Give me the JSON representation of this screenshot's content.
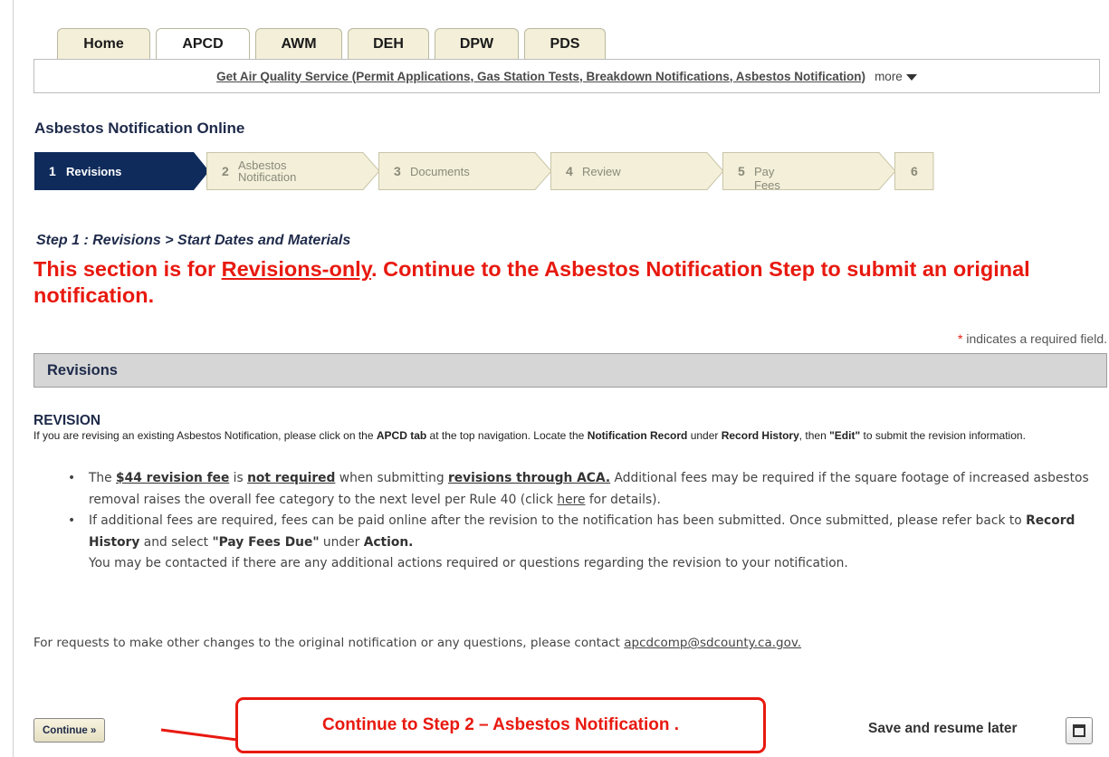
{
  "tabs": [
    {
      "label": "Home",
      "active": false
    },
    {
      "label": "APCD",
      "active": true
    },
    {
      "label": "AWM",
      "active": false
    },
    {
      "label": "DEH",
      "active": false
    },
    {
      "label": "DPW",
      "active": false
    },
    {
      "label": "PDS",
      "active": false
    }
  ],
  "subnav": {
    "link": "Get Air Quality Service (Permit Applications, Gas Station Tests, Breakdown Notifications, Asbestos Notification)",
    "more": "more"
  },
  "page_title": "Asbestos Notification Online",
  "steps": [
    {
      "num": "1",
      "label": "Revisions",
      "active": true
    },
    {
      "num": "2",
      "label_line1": "Asbestos",
      "label_line2": "Notification",
      "active": false
    },
    {
      "num": "3",
      "label": "Documents",
      "active": false
    },
    {
      "num": "4",
      "label": "Review",
      "active": false
    },
    {
      "num": "5",
      "label": "Pay Fees",
      "active": false
    },
    {
      "num": "6",
      "label": "",
      "active": false
    }
  ],
  "step_heading": "Step 1 : Revisions > Start Dates and Materials",
  "warning": {
    "pre": "This section is for ",
    "underlined": "Revisions-only",
    "post": ". Continue to the Asbestos Notification Step to submit an original notification."
  },
  "required_note": {
    "star": "*",
    "text": "indicates a required field."
  },
  "section_title": "Revisions",
  "revision": {
    "title": "REVISION",
    "t1": "If you are revising an existing Asbestos Notification, please click on the ",
    "b1": "APCD tab",
    "t2": " at the top navigation. Locate the ",
    "b2": "Notification Record",
    "t3": " under ",
    "b3": "Record History",
    "t4": ", then ",
    "b4": "\"Edit\"",
    "t5": " to submit the revision information."
  },
  "bullet1": {
    "t1": "The ",
    "b1": "$44 revision fee",
    "t2": " is ",
    "b2": "not required",
    "t3": " when submitting ",
    "b3": "revisions through ACA.",
    "t4": " Additional fees may be required if the square footage of increased asbestos removal raises the overall fee category to the next level per Rule 40 (click ",
    "link": "here",
    "t5": " for details)."
  },
  "bullet2": {
    "t1": "If additional fees are required, fees can be paid online after the revision to the notification has been submitted. Once submitted, please refer back to ",
    "b1": "Record History",
    "t2": " and select ",
    "b2": "\"Pay Fees Due\"",
    "t3": " under ",
    "b3": "Action.",
    "t4": "You may be contacted if there are any additional actions required or questions regarding the revision to your notification."
  },
  "contact": {
    "text": "For requests to make other changes to the original notification or any questions, please contact ",
    "email": "apcdcomp@sdcounty.ca.gov."
  },
  "continue_label": "Continue »",
  "callout_text": "Continue to Step 2 – Asbestos Notification .",
  "save_later": "Save and resume later",
  "colors": {
    "accent_red": "#e8190f",
    "navy": "#0f2b5b",
    "step_bg": "#f3efd9"
  }
}
